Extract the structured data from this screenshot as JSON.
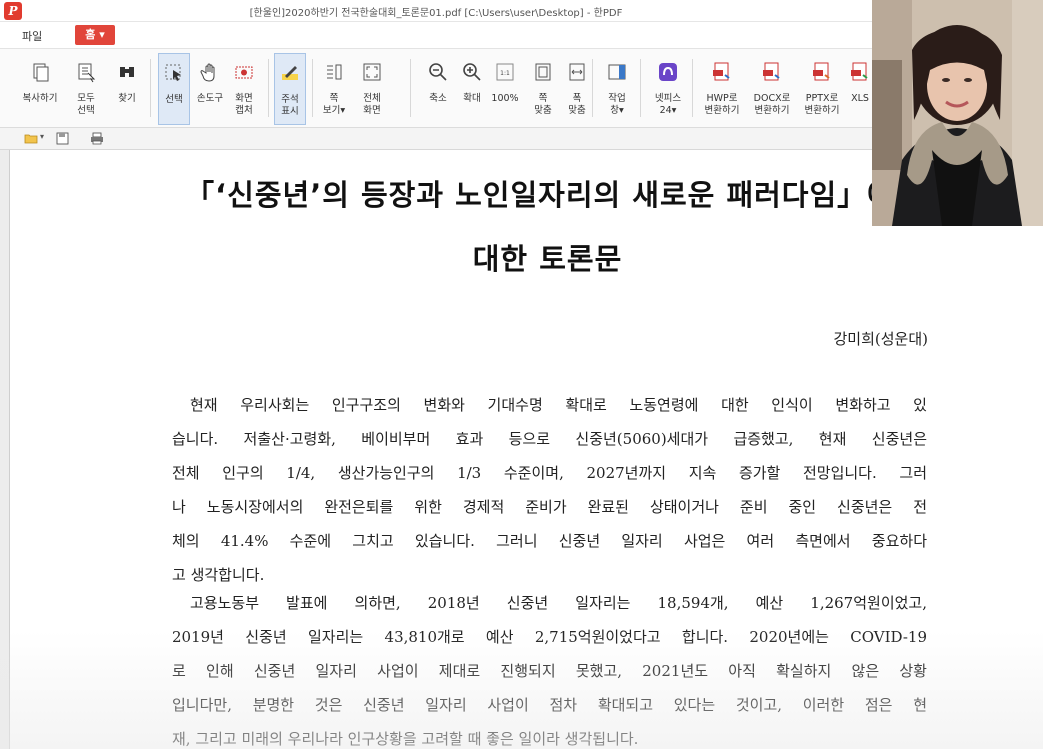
{
  "window": {
    "title": "[한울인]2020하반기 전국한술대회_토론문01.pdf [C:\\Users\\user\\Desktop] - 한PDF"
  },
  "menu": {
    "file": "파일",
    "home": "홈 ▾"
  },
  "ribbon": {
    "buttons": [
      {
        "label": "복사하기",
        "icon": "copy-icon"
      },
      {
        "label": "모두\n선택",
        "icon": "select-all-icon"
      },
      {
        "label": "찾기",
        "icon": "find-icon"
      },
      {
        "label": "선택",
        "icon": "select-cursor-icon"
      },
      {
        "label": "손도구",
        "icon": "hand-tool-icon"
      },
      {
        "label": "화면\n캡처",
        "icon": "screen-capture-icon"
      },
      {
        "label": "주석\n표시",
        "icon": "annotation-icon"
      },
      {
        "label": "쪽\n보기▾",
        "icon": "page-view-icon"
      },
      {
        "label": "전체\n화면",
        "icon": "fullscreen-icon"
      },
      {
        "label": "축소",
        "icon": "zoom-out-icon"
      },
      {
        "label": "확대",
        "icon": "zoom-in-icon"
      },
      {
        "label": "100%",
        "icon": "zoom-100-icon"
      },
      {
        "label": "쪽\n맞춤",
        "icon": "fit-page-icon"
      },
      {
        "label": "폭\n맞춤",
        "icon": "fit-width-icon"
      },
      {
        "label": "작업\n창▾",
        "icon": "task-pane-icon"
      },
      {
        "label": "넷피스\n24▾",
        "icon": "netffice-icon"
      },
      {
        "label": "HWP로\n변환하기",
        "icon": "convert-hwp-icon"
      },
      {
        "label": "DOCX로\n변환하기",
        "icon": "convert-docx-icon"
      },
      {
        "label": "PPTX로\n변환하기",
        "icon": "convert-pptx-icon"
      },
      {
        "label": "XLS",
        "icon": "convert-xls-icon"
      }
    ]
  },
  "document": {
    "title_line1": "「‘신중년’의 등장과 노인일자리의 새로운 패러다임」에",
    "title_line2": "대한 토론문",
    "author": "강미희(성운대)",
    "paragraph1": [
      "현재 우리사회는 인구구조의 변화와 기대수명 확대로 노동연령에 대한 인식이 변화하고 있",
      "습니다. 저출산·고령화, 베이비부머 효과 등으로 신중년(5060)세대가 급증했고, 현재 신중년은",
      "전체 인구의 1/4, 생산가능인구의 1/3 수준이며, 2027년까지 지속 증가할 전망입니다. 그러",
      "나 노동시장에서의 완전은퇴를 위한 경제적 준비가 완료된 상태이거나 준비 중인 신중년은 전",
      "체의 41.4% 수준에 그치고 있습니다. 그러니 신중년 일자리 사업은 여러 측면에서 중요하다",
      "고 생각합니다."
    ],
    "paragraph2": [
      "고용노동부 발표에 의하면, 2018년 신중년 일자리는 18,594개, 예산 1,267억원이었고,",
      "2019년 신중년 일자리는 43,810개로 예산 2,715억원이었다고 합니다. 2020년에는 COVID-19",
      "로 인해 신중년 일자리 사업이 제대로 진행되지 못했고, 2021년도 아직 확실하지 않은 상황",
      "입니다만, 분명한 것은 신중년 일자리 사업이 점차 확대되고 있다는 것이고, 이러한 점은 현",
      "재, 그리고 미래의 우리나라 인구상황을 고려할 때 좋은 일이라 생각됩니다."
    ]
  }
}
